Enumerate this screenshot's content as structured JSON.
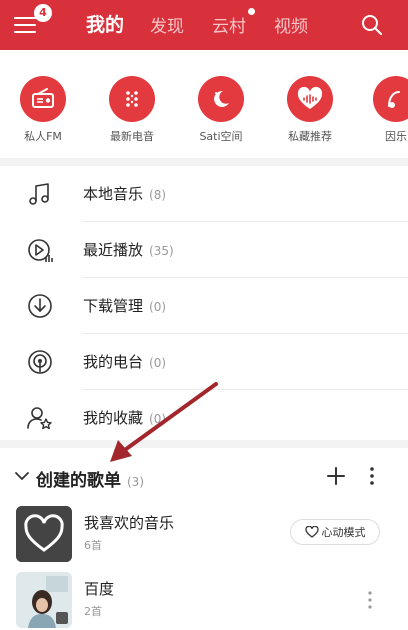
{
  "header": {
    "badge_count": "4",
    "tabs": [
      {
        "label": "我的",
        "active": true
      },
      {
        "label": "发现",
        "active": false
      },
      {
        "label": "云村",
        "active": false,
        "has_dot": true
      },
      {
        "label": "视频",
        "active": false
      }
    ],
    "brand_color": "#d9313b"
  },
  "quick": {
    "items": [
      {
        "label": "私人FM",
        "icon": "radio-icon"
      },
      {
        "label": "最新电音",
        "icon": "dots-grid-icon"
      },
      {
        "label": "Sati空间",
        "icon": "moon-icon"
      },
      {
        "label": "私藏推荐",
        "icon": "heart-wave-icon"
      },
      {
        "label": "因乐",
        "icon": "partial-icon"
      }
    ]
  },
  "list": {
    "items": [
      {
        "label": "本地音乐",
        "count": "(8)",
        "icon": "music-note-icon"
      },
      {
        "label": "最近播放",
        "count": "(35)",
        "icon": "recent-play-icon"
      },
      {
        "label": "下载管理",
        "count": "(0)",
        "icon": "download-icon"
      },
      {
        "label": "我的电台",
        "count": "(0)",
        "icon": "podcast-icon"
      },
      {
        "label": "我的收藏",
        "count": "(0)",
        "icon": "user-star-icon"
      }
    ]
  },
  "playlists": {
    "title": "创建的歌单",
    "count": "(3)",
    "items": [
      {
        "title": "我喜欢的音乐",
        "subtitle": "6首",
        "mode_label": "心动模式"
      },
      {
        "title": "百度",
        "subtitle": "2首"
      }
    ]
  }
}
